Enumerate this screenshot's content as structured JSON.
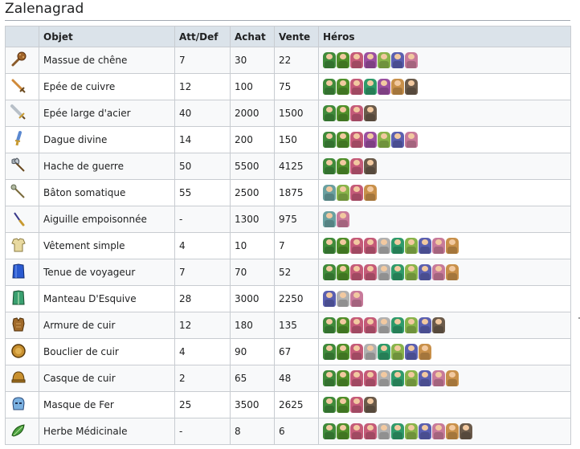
{
  "page": {
    "title": "Zalenagrad"
  },
  "table": {
    "headers": {
      "icon": "",
      "objet": "Objet",
      "attdef": "Att/Def",
      "achat": "Achat",
      "vente": "Vente",
      "heros": "Héros"
    },
    "rows": [
      {
        "icon": "club-icon",
        "objet": "Massue de chêne",
        "attdef": "7",
        "achat": "30",
        "vente": "22",
        "heroes": [
          "#3f8a3a",
          "#4f8f2a",
          "#c45a78",
          "#9a4fa0",
          "#88b34a",
          "#5a5fb0",
          "#c87a9a"
        ]
      },
      {
        "icon": "copper-sword-icon",
        "objet": "Epée de cuivre",
        "attdef": "12",
        "achat": "100",
        "vente": "75",
        "heroes": [
          "#3f8a3a",
          "#4f8f2a",
          "#c45a78",
          "#2f9a6a",
          "#9a4fa0",
          "#c8904a",
          "#6a5a4a"
        ]
      },
      {
        "icon": "steel-broadsword-icon",
        "objet": "Epée large d'acier",
        "attdef": "40",
        "achat": "2000",
        "vente": "1500",
        "heroes": [
          "#3f8a3a",
          "#4f8f2a",
          "#c45a78",
          "#6a5a4a"
        ]
      },
      {
        "icon": "divine-dagger-icon",
        "objet": "Dague divine",
        "attdef": "14",
        "achat": "200",
        "vente": "150",
        "heroes": [
          "#3f8a3a",
          "#4f8f2a",
          "#c45a78",
          "#9a4fa0",
          "#88b34a",
          "#5a5fb0",
          "#c87a9a"
        ]
      },
      {
        "icon": "war-axe-icon",
        "objet": "Hache de guerre",
        "attdef": "50",
        "achat": "5500",
        "vente": "4125",
        "heroes": [
          "#3f8a3a",
          "#4f8f2a",
          "#c45a78",
          "#6a5a4a"
        ]
      },
      {
        "icon": "somatic-staff-icon",
        "objet": "Bâton somatique",
        "attdef": "55",
        "achat": "2500",
        "vente": "1875",
        "heroes": [
          "#6aa0a0",
          "#88b34a",
          "#c45a78",
          "#c8904a"
        ]
      },
      {
        "icon": "poison-needle-icon",
        "objet": "Aiguille empoisonnée",
        "attdef": "-",
        "achat": "1300",
        "vente": "975",
        "heroes": [
          "#6aa0a0",
          "#c87a9a"
        ]
      },
      {
        "icon": "plain-clothes-icon",
        "objet": "Vêtement simple",
        "attdef": "4",
        "achat": "10",
        "vente": "7",
        "heroes": [
          "#3f8a3a",
          "#4f8f2a",
          "#c45a78",
          "#c45a78",
          "#b0b0b0",
          "#2f9a6a",
          "#88b34a",
          "#5a5fb0",
          "#c87a9a",
          "#c8904a"
        ]
      },
      {
        "icon": "travelers-clothes-icon",
        "objet": "Tenue de voyageur",
        "attdef": "7",
        "achat": "70",
        "vente": "52",
        "heroes": [
          "#3f8a3a",
          "#4f8f2a",
          "#c45a78",
          "#c45a78",
          "#b0b0b0",
          "#2f9a6a",
          "#88b34a",
          "#5a5fb0",
          "#c87a9a",
          "#c8904a"
        ]
      },
      {
        "icon": "dodge-cloak-icon",
        "objet": "Manteau D'Esquive",
        "attdef": "28",
        "achat": "3000",
        "vente": "2250",
        "heroes": [
          "#5a5fb0",
          "#b0b0b0",
          "#c87a9a"
        ]
      },
      {
        "icon": "leather-armour-icon",
        "objet": "Armure de cuir",
        "attdef": "12",
        "achat": "180",
        "vente": "135",
        "heroes": [
          "#3f8a3a",
          "#4f8f2a",
          "#c45a78",
          "#c45a78",
          "#b0b0b0",
          "#2f9a6a",
          "#88b34a",
          "#5a5fb0",
          "#6a5a4a"
        ]
      },
      {
        "icon": "leather-shield-icon",
        "objet": "Bouclier de cuir",
        "attdef": "4",
        "achat": "90",
        "vente": "67",
        "heroes": [
          "#3f8a3a",
          "#4f8f2a",
          "#c45a78",
          "#b0b0b0",
          "#2f9a6a",
          "#88b34a",
          "#5a5fb0",
          "#c8904a"
        ]
      },
      {
        "icon": "leather-hat-icon",
        "objet": "Casque de cuir",
        "attdef": "2",
        "achat": "65",
        "vente": "48",
        "heroes": [
          "#3f8a3a",
          "#4f8f2a",
          "#c45a78",
          "#c45a78",
          "#b0b0b0",
          "#2f9a6a",
          "#88b34a",
          "#5a5fb0",
          "#c87a9a",
          "#c8904a"
        ]
      },
      {
        "icon": "iron-mask-icon",
        "objet": "Masque de Fer",
        "attdef": "25",
        "achat": "3500",
        "vente": "2625",
        "heroes": [
          "#3f8a3a",
          "#4f8f2a",
          "#c45a78",
          "#6a5a4a"
        ]
      },
      {
        "icon": "medicinal-herb-icon",
        "objet": "Herbe Médicinale",
        "attdef": "-",
        "achat": "8",
        "vente": "6",
        "heroes": [
          "#3f8a3a",
          "#4f8f2a",
          "#c45a78",
          "#c45a78",
          "#b0b0b0",
          "#2f9a6a",
          "#88b34a",
          "#5a5fb0",
          "#c87a9a",
          "#c8904a",
          "#6a5a4a"
        ]
      }
    ]
  }
}
